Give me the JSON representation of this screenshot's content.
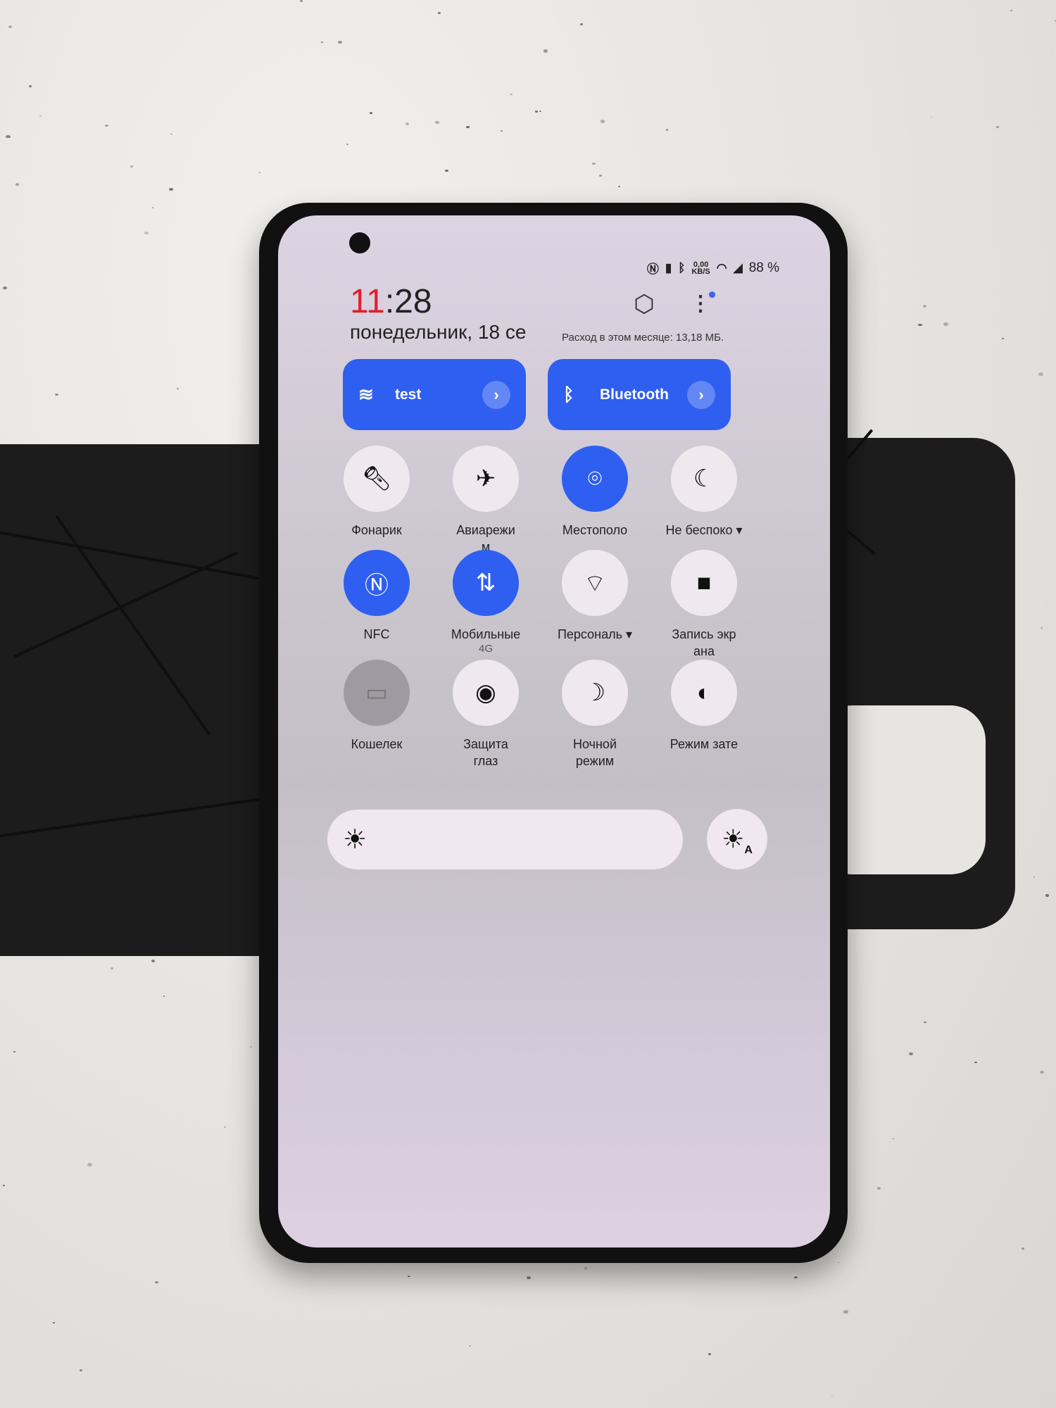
{
  "status_bar": {
    "icons": [
      "nfc-icon",
      "vibrate-icon",
      "bluetooth-icon",
      "wifi-icon",
      "signal-icon"
    ],
    "net_speed": "0,00",
    "net_unit": "KB/S",
    "battery": "88 %"
  },
  "header": {
    "time_hour": "11",
    "time_rest": ":28",
    "date": "понедельник, 18 се",
    "usage": "Расход в этом месяце: 13,18 МБ."
  },
  "big_tiles": [
    {
      "label": "test",
      "icon": "wifi-icon"
    },
    {
      "label": "Bluetooth",
      "icon": "bluetooth-icon"
    }
  ],
  "tiles": [
    {
      "label": "Фонарик",
      "icon": "flashlight-icon",
      "state": "off"
    },
    {
      "label": "Авиарежи\nм",
      "icon": "airplane-icon",
      "state": "off"
    },
    {
      "label": "Местополо",
      "icon": "location-icon",
      "state": "on"
    },
    {
      "label": "Не беспоко ▾",
      "icon": "moon-icon",
      "state": "off"
    },
    {
      "label": "NFC",
      "icon": "nfc-icon",
      "state": "on"
    },
    {
      "label": "Мобильные",
      "sub": "4G",
      "icon": "mobile-data-icon",
      "state": "on"
    },
    {
      "label": "Персональ ▾",
      "icon": "hotspot-icon",
      "state": "off"
    },
    {
      "label": "Запись экр\nана",
      "icon": "screen-record-icon",
      "state": "off"
    },
    {
      "label": "Кошелек",
      "icon": "wallet-icon",
      "state": "disabled"
    },
    {
      "label": "Защита\nглаз",
      "icon": "eye-icon",
      "state": "off"
    },
    {
      "label": "Ночной\nрежим",
      "icon": "night-mode-icon",
      "state": "off"
    },
    {
      "label": "Режим зате",
      "icon": "dark-mode-icon",
      "state": "off"
    }
  ],
  "colors": {
    "accent": "#2f5ff0",
    "clock_hour": "#e02030"
  }
}
